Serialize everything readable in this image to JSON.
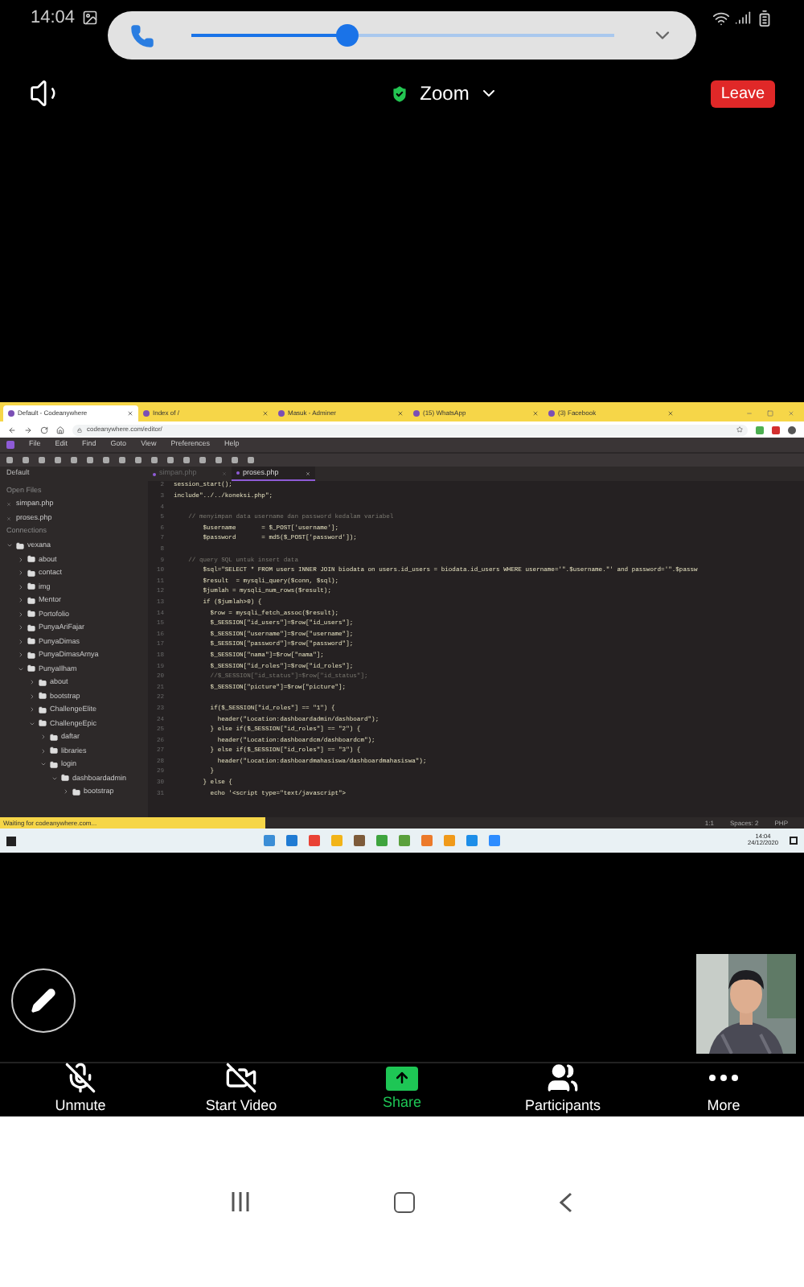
{
  "phone_status": {
    "time": "14:04"
  },
  "call_bar": {
    "level": 0.37
  },
  "meeting_header": {
    "title": "Zoom",
    "leave": "Leave"
  },
  "shared_screen": {
    "browser_tabs": [
      {
        "label": "Default - Codeanywhere",
        "selected": true
      },
      {
        "label": "Index of /",
        "selected": false
      },
      {
        "label": "Masuk - Adminer",
        "selected": false
      },
      {
        "label": "(15) WhatsApp",
        "selected": false
      },
      {
        "label": "(3) Facebook",
        "selected": false
      }
    ],
    "url": "codeanywhere.com/editor/",
    "menu": [
      "File",
      "Edit",
      "Find",
      "Goto",
      "View",
      "Preferences",
      "Help"
    ],
    "panel_title": "Default",
    "editor_tabs": [
      {
        "label": "simpan.php",
        "selected": false
      },
      {
        "label": "proses.php",
        "selected": true
      }
    ],
    "sidebar": {
      "open_files_title": "Open Files",
      "open_files": [
        "simpan.php",
        "proses.php"
      ],
      "connections_title": "Connections",
      "tree": [
        {
          "label": "vexana",
          "expanded": true,
          "children": [
            {
              "label": "about",
              "expanded": false
            },
            {
              "label": "contact",
              "expanded": false
            },
            {
              "label": "img",
              "expanded": false
            },
            {
              "label": "Mentor",
              "expanded": false
            },
            {
              "label": "Portofolio",
              "expanded": false
            },
            {
              "label": "PunyaAriFajar",
              "expanded": false
            },
            {
              "label": "PunyaDimas",
              "expanded": false
            },
            {
              "label": "PunyaDimasArnya",
              "expanded": false
            },
            {
              "label": "PunyaIlham",
              "expanded": true,
              "children": [
                {
                  "label": "about",
                  "expanded": false
                },
                {
                  "label": "bootstrap",
                  "expanded": false
                },
                {
                  "label": "ChallengeElite",
                  "expanded": false
                },
                {
                  "label": "ChallengeEpic",
                  "expanded": true,
                  "children": [
                    {
                      "label": "daftar",
                      "expanded": false
                    },
                    {
                      "label": "libraries",
                      "expanded": false
                    },
                    {
                      "label": "login",
                      "expanded": true,
                      "children": [
                        {
                          "label": "dashboardadmin",
                          "expanded": true,
                          "children": [
                            {
                              "label": "bootstrap",
                              "expanded": false
                            }
                          ]
                        }
                      ]
                    }
                  ]
                }
              ]
            }
          ]
        }
      ]
    },
    "code_lines": [
      {
        "number": "2",
        "text": "session_start();",
        "kind": "code"
      },
      {
        "number": "3",
        "text": "include\"../../koneksi.php\";",
        "kind": "code"
      },
      {
        "number": "4",
        "kind": "code"
      },
      {
        "number": "5",
        "text": "    // menyimpan data username dan password kedalam variabel",
        "kind": "comment"
      },
      {
        "number": "6",
        "text": "        $username       = $_POST['username'];",
        "kind": "code"
      },
      {
        "number": "7",
        "text": "        $password       = md5($_POST['password']);",
        "kind": "code"
      },
      {
        "number": "8",
        "kind": "code"
      },
      {
        "number": "9",
        "text": "    // query SQL untuk insert data",
        "kind": "comment"
      },
      {
        "number": "10",
        "text": "        $sql=\"SELECT * FROM users INNER JOIN biodata on users.id_users = biodata.id_users WHERE username='\".$username.\"' and password='\".$passw",
        "kind": "code"
      },
      {
        "number": "11",
        "text": "        $result  = mysqli_query($conn, $sql);",
        "kind": "code"
      },
      {
        "number": "12",
        "text": "        $jumlah = mysqli_num_rows($result);",
        "kind": "code"
      },
      {
        "number": "13",
        "text": "        if ($jumlah>0) {",
        "kind": "code"
      },
      {
        "number": "14",
        "text": "          $row = mysqli_fetch_assoc($result);",
        "kind": "code"
      },
      {
        "number": "15",
        "text": "          $_SESSION[\"id_users\"]=$row[\"id_users\"];",
        "kind": "code"
      },
      {
        "number": "16",
        "text": "          $_SESSION[\"username\"]=$row[\"username\"];",
        "kind": "code"
      },
      {
        "number": "17",
        "text": "          $_SESSION[\"password\"]=$row[\"password\"];",
        "kind": "code"
      },
      {
        "number": "18",
        "text": "          $_SESSION[\"nama\"]=$row[\"nama\"];",
        "kind": "code"
      },
      {
        "number": "19",
        "text": "          $_SESSION[\"id_roles\"]=$row[\"id_roles\"];",
        "kind": "code"
      },
      {
        "number": "20",
        "text": "          //$_SESSION[\"id_status\"]=$row[\"id_status\"];",
        "kind": "comment"
      },
      {
        "number": "21",
        "text": "          $_SESSION[\"picture\"]=$row[\"picture\"];",
        "kind": "code"
      },
      {
        "number": "22",
        "kind": "code"
      },
      {
        "number": "23",
        "text": "          if($_SESSION[\"id_roles\"] == \"1\") {",
        "kind": "code"
      },
      {
        "number": "24",
        "text": "            header(\"Location:dashboardadmin/dashboard\");",
        "kind": "code"
      },
      {
        "number": "25",
        "text": "          } else if($_SESSION[\"id_roles\"] == \"2\") {",
        "kind": "code"
      },
      {
        "number": "26",
        "text": "            header(\"Location:dashboardcm/dashboardcm\");",
        "kind": "code"
      },
      {
        "number": "27",
        "text": "          } else if($_SESSION[\"id_roles\"] == \"3\") {",
        "kind": "code"
      },
      {
        "number": "28",
        "text": "            header(\"Location:dashboardmahasiswa/dashboardmahasiswa\");",
        "kind": "code"
      },
      {
        "number": "29",
        "text": "          }",
        "kind": "code"
      },
      {
        "number": "30",
        "text": "        } else {",
        "kind": "code"
      },
      {
        "number": "31",
        "text": "          echo '<script type=\"text/javascript\">",
        "kind": "code"
      }
    ],
    "status_text": "Waiting for codeanywhere.com...",
    "editor_status": [
      "1:1",
      "Spaces: 2",
      "PHP"
    ],
    "taskbar": {
      "time": "14:04",
      "date": "24/12/2020"
    }
  },
  "toolbar": [
    {
      "label": "Unmute",
      "kind": "mic"
    },
    {
      "label": "Start Video",
      "kind": "video"
    },
    {
      "label": "Share",
      "kind": "share"
    },
    {
      "label": "Participants",
      "kind": "participants"
    },
    {
      "label": "More",
      "kind": "more"
    }
  ]
}
